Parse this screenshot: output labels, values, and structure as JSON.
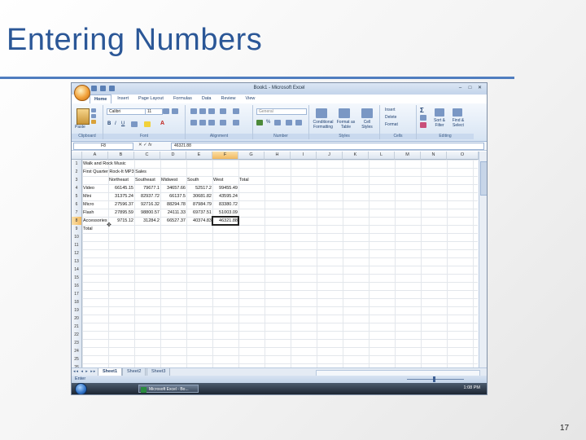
{
  "slide": {
    "title": "Entering Numbers",
    "page_number": "17"
  },
  "window": {
    "title": "Book1 - Microsoft Excel"
  },
  "ribbon": {
    "tabs": [
      "Home",
      "Insert",
      "Page Layout",
      "Formulas",
      "Data",
      "Review",
      "View"
    ],
    "active_tab": "Home",
    "font_name": "Calibri",
    "font_size": "11",
    "number_format": "General",
    "groups": {
      "clipboard": "Clipboard",
      "font": "Font",
      "alignment": "Alignment",
      "number": "Number",
      "styles": "Styles",
      "cells": "Cells",
      "editing": "Editing"
    },
    "buttons": {
      "paste": "Paste",
      "conditional_formatting": "Conditional Formatting",
      "format_as_table": "Format as Table",
      "cell_styles": "Cell Styles",
      "insert": "Insert",
      "delete": "Delete",
      "format": "Format",
      "sort_filter": "Sort & Filter",
      "find_select": "Find & Select"
    }
  },
  "formula_bar": {
    "name_box": "F8",
    "fx": "fx",
    "content": "46321.88"
  },
  "columns": [
    "A",
    "B",
    "C",
    "D",
    "E",
    "F",
    "G",
    "H",
    "I",
    "J",
    "K",
    "L",
    "M",
    "N",
    "O"
  ],
  "selected_column": "F",
  "row_numbers": [
    "1",
    "2",
    "3",
    "4",
    "5",
    "6",
    "7",
    "8",
    "9",
    "10",
    "11",
    "12",
    "13",
    "14",
    "15",
    "16",
    "17",
    "18",
    "19",
    "20",
    "21",
    "22",
    "23",
    "24",
    "25",
    "26"
  ],
  "selected_row": "8",
  "sheet": {
    "A1": "Walk and Rock Music",
    "A2": "First Quarter Rock-It MP3 Sales",
    "headers": [
      "Northeast",
      "Southeast",
      "Midwest",
      "South",
      "West",
      "Total"
    ],
    "rows": [
      {
        "label": "Video",
        "values": [
          "66145.15",
          "79677.1",
          "34657.66",
          "52517.2",
          "99455.49"
        ]
      },
      {
        "label": "Mini",
        "values": [
          "31375.24",
          "82937.72",
          "66137.5",
          "30681.82",
          "43595.24"
        ]
      },
      {
        "label": "Micro",
        "values": [
          "27596.37",
          "92716.32",
          "88294.78",
          "87984.79",
          "83380.72"
        ]
      },
      {
        "label": "Flash",
        "values": [
          "27895.59",
          "98800.57",
          "24111.33",
          "69737.51",
          "51003.09"
        ]
      },
      {
        "label": "Accessories",
        "values": [
          "9715.12",
          "31284.2",
          "66527.37",
          "40374.83",
          "46321.88"
        ]
      }
    ],
    "A9": "Total"
  },
  "sheet_tabs": [
    "Sheet1",
    "Sheet2",
    "Sheet3"
  ],
  "active_sheet": "Sheet1",
  "status": {
    "mode": "Enter"
  },
  "taskbar": {
    "app_label": "Microsoft Excel - Bo...",
    "clock": "1:08 PM"
  }
}
